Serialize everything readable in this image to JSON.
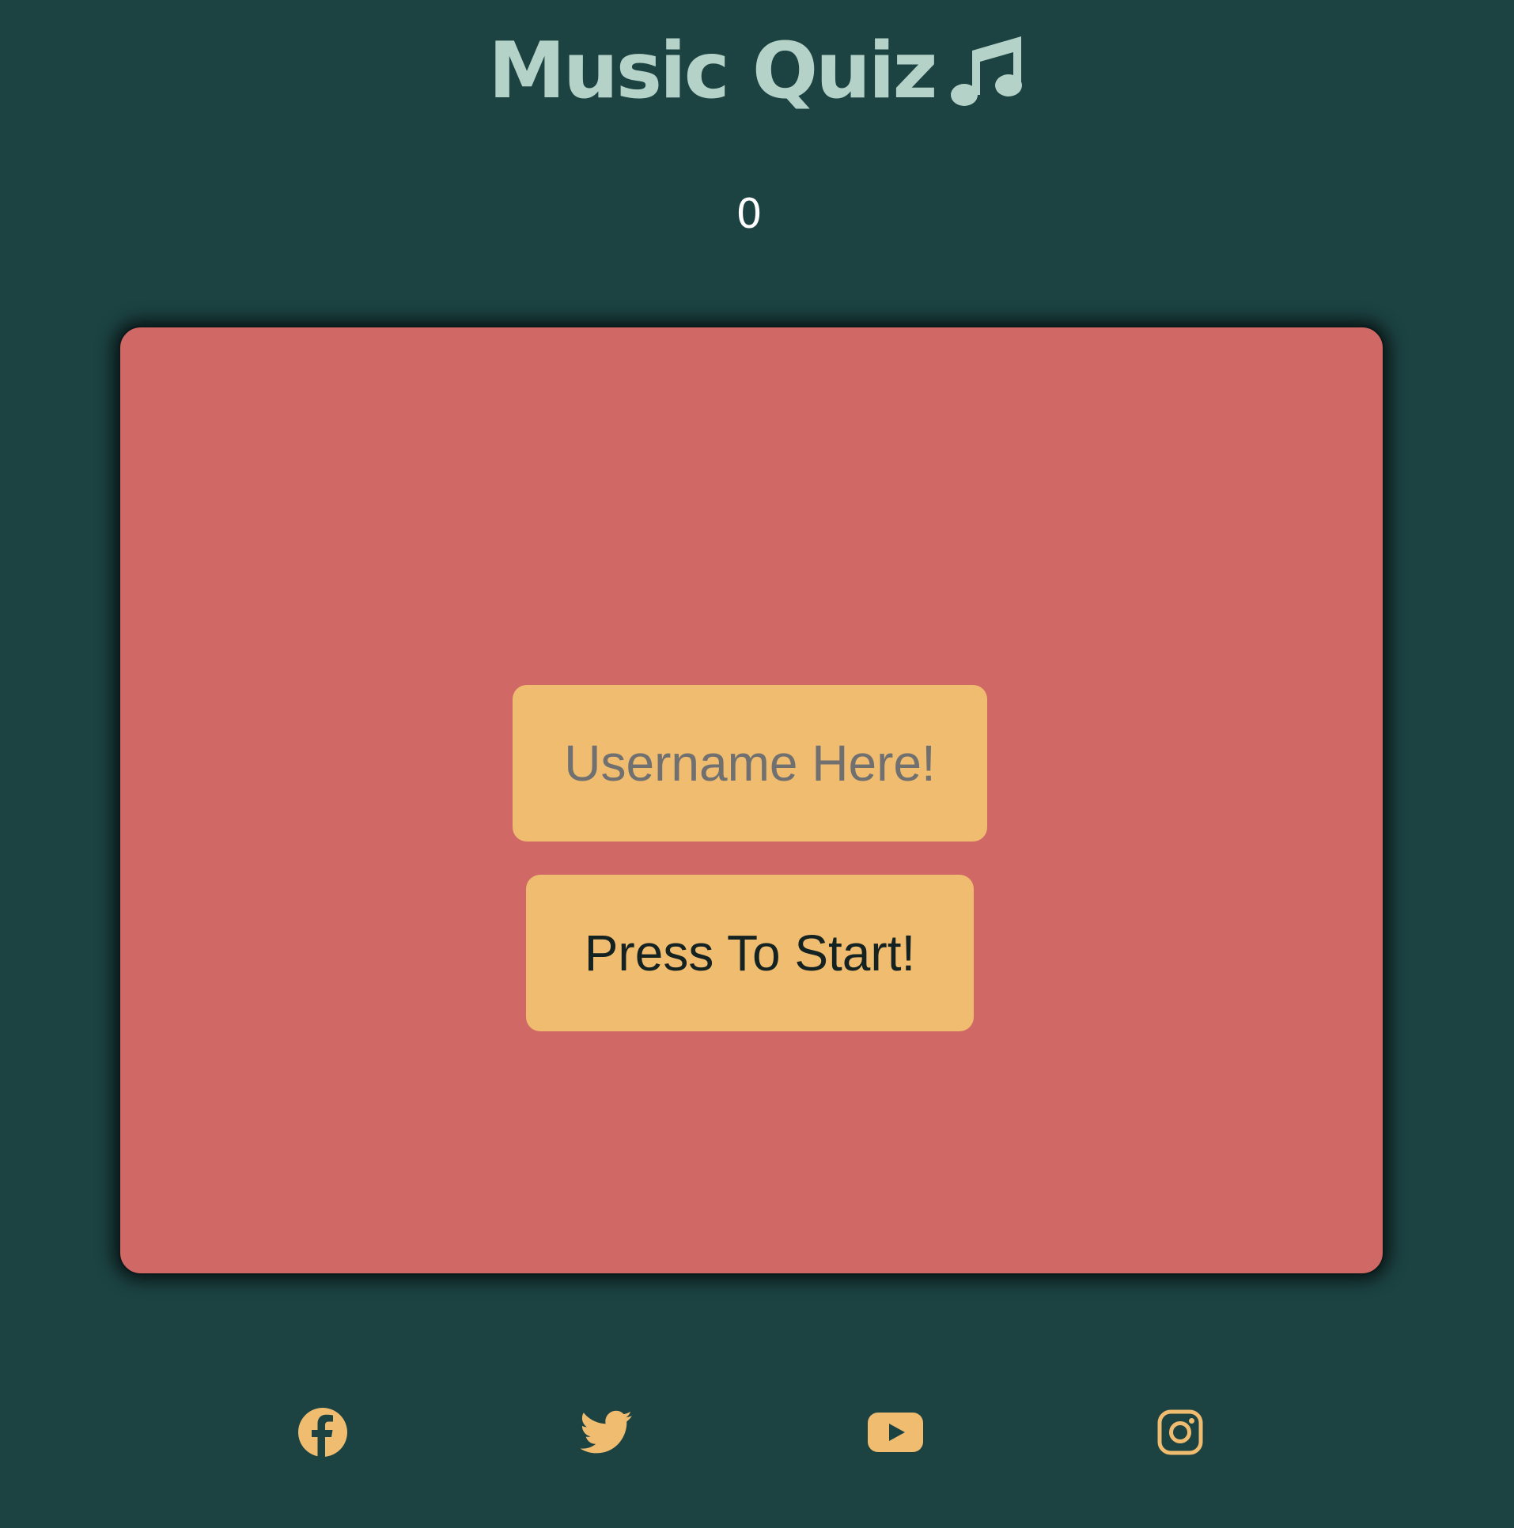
{
  "header": {
    "title": "Music Quiz",
    "icon": "music-note-icon"
  },
  "score": {
    "value": "0"
  },
  "quiz_card": {
    "username_input": {
      "value": "",
      "placeholder": "Username Here!"
    },
    "start_button_label": "Press To Start!"
  },
  "footer": {
    "social_links": [
      {
        "icon": "facebook-icon"
      },
      {
        "icon": "twitter-icon"
      },
      {
        "icon": "youtube-icon"
      },
      {
        "icon": "instagram-icon"
      }
    ]
  },
  "colors": {
    "background": "#1c4242",
    "title": "#b4d2c8",
    "card": "#d06966",
    "button": "#f0bd70",
    "icon": "#f0bd70",
    "score": "#ffffff"
  }
}
